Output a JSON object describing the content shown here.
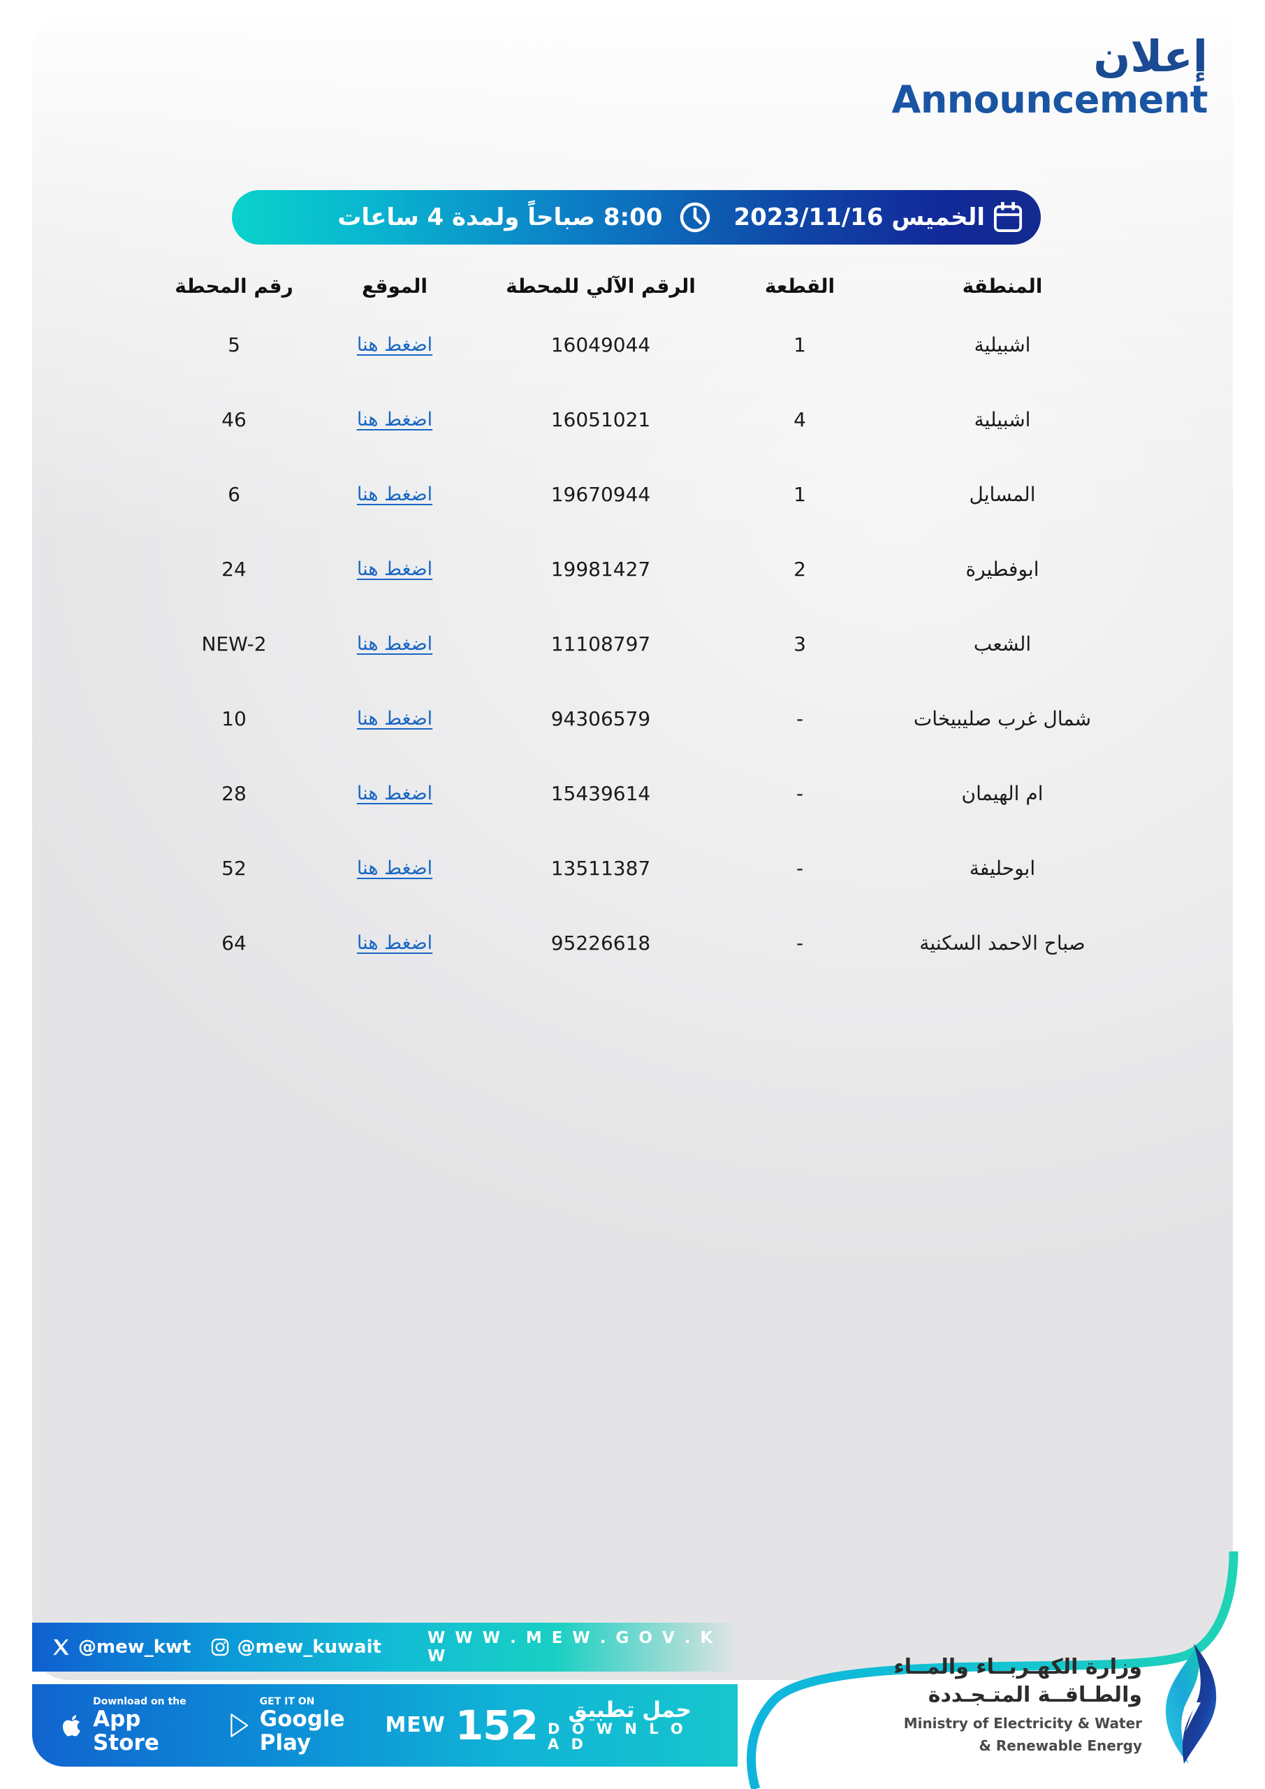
{
  "header": {
    "title_ar": "إعلان",
    "title_en": "Announcement"
  },
  "banner": {
    "calendar_icon": "calendar-icon",
    "date": "الخميس 2023/11/16",
    "clock_icon": "clock-icon",
    "time": "8:00 صباحاً ولمدة 4 ساعات",
    "gradient_start": "#0ad2cb",
    "gradient_end": "#132a8f"
  },
  "table": {
    "headers": {
      "station_no": "رقم المحطة",
      "location": "الموقع",
      "auto_no": "الرقم الآلي للمحطة",
      "block": "القطعة",
      "region": "المنطقة"
    },
    "link_label": "اضغط هنا",
    "link_color": "#1966c4",
    "rows": [
      {
        "region": "اشبيلية",
        "block": "1",
        "auto_no": "16049044",
        "location": "اضغط هنا",
        "station_no": "5"
      },
      {
        "region": "اشبيلية",
        "block": "4",
        "auto_no": "16051021",
        "location": "اضغط هنا",
        "station_no": "46"
      },
      {
        "region": "المسايل",
        "block": "1",
        "auto_no": "19670944",
        "location": "اضغط هنا",
        "station_no": "6"
      },
      {
        "region": "ابوفطيرة",
        "block": "2",
        "auto_no": "19981427",
        "location": "اضغط هنا",
        "station_no": "24"
      },
      {
        "region": "الشعب",
        "block": "3",
        "auto_no": "11108797",
        "location": "اضغط هنا",
        "station_no": "NEW-2"
      },
      {
        "region": "شمال غرب صليبيخات",
        "block": "-",
        "auto_no": "94306579",
        "location": "اضغط هنا",
        "station_no": "10"
      },
      {
        "region": "ام الهيمان",
        "block": "-",
        "auto_no": "15439614",
        "location": "اضغط هنا",
        "station_no": "28"
      },
      {
        "region": "ابوحليفة",
        "block": "-",
        "auto_no": "13511387",
        "location": "اضغط هنا",
        "station_no": "52"
      },
      {
        "region": "صباح الاحمد السكنية",
        "block": "-",
        "auto_no": "95226618",
        "location": "اضغط هنا",
        "station_no": "64"
      }
    ]
  },
  "footer": {
    "social": {
      "x_icon": "x-twitter-icon",
      "x_handle": "@mew_kwt",
      "instagram_icon": "instagram-icon",
      "instagram_handle": "@mew_kuwait",
      "website": "W W W . M E W . G O V . K W"
    },
    "apps": {
      "appstore_icon": "apple-icon",
      "appstore_sub": "Download on the",
      "appstore_main": "App Store",
      "googleplay_icon": "google-play-icon",
      "googleplay_sub": "GET IT ON",
      "googleplay_main": "Google Play",
      "mew_label": "MEW",
      "mew_number": "152",
      "download_ar": "حمل تطبيق",
      "download_en": "D O W N L O A D"
    },
    "ministry": {
      "logo_icon": "mew-leaf-bolt-logo",
      "name_ar_line1": "وزارة الكهـربــاء والمــاء",
      "name_ar_line2": "والطـاقــة المتـجـددة",
      "name_en_line1": "Ministry of Electricity & Water",
      "name_en_line2": "& Renewable Energy"
    }
  }
}
